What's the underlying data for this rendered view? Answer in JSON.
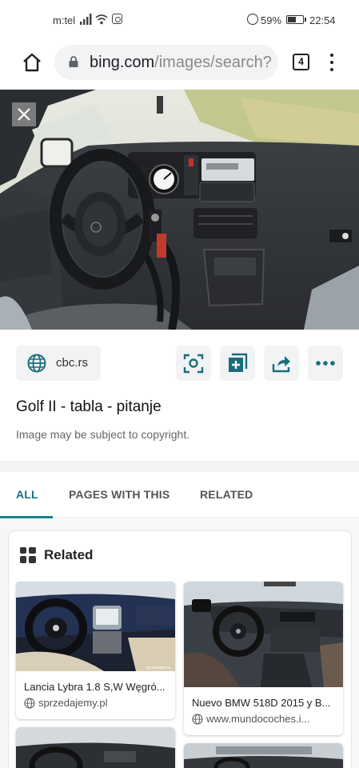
{
  "status_bar": {
    "carrier": "m:tel",
    "battery_percent": "59%",
    "battery_level": 0.59,
    "time": "22:54",
    "icons": [
      "signal-icon",
      "wifi-icon",
      "instagram-icon",
      "alarm-icon",
      "battery-icon"
    ]
  },
  "browser": {
    "url_domain": "bing.com",
    "url_path": "/images/search?",
    "tab_count": "4",
    "icons": [
      "home-icon",
      "lock-icon",
      "tabs-icon",
      "more-vert-icon"
    ]
  },
  "image_detail": {
    "close_icon": "close-icon",
    "source": "cbc.rs",
    "title": "Golf II - tabla - pitanje",
    "copyright_note": "Image may be subject to copyright.",
    "actions": [
      "visual-search-icon",
      "add-collection-icon",
      "share-icon",
      "more-horiz-icon"
    ]
  },
  "tabs": [
    {
      "label": "ALL",
      "active": true
    },
    {
      "label": "PAGES WITH THIS",
      "active": false
    },
    {
      "label": "RELATED",
      "active": false
    }
  ],
  "related": {
    "heading": "Related",
    "items": [
      {
        "title": "Lancia Lybra 1.8 S,W Węgró...",
        "source": "sprzedajemy.pl",
        "watermark": "sprzedajemy"
      },
      {
        "title": "Nuevo BMW 518D 2015 y B...",
        "source": "www.mundocoches.i..."
      },
      {
        "title": "",
        "source": ""
      },
      {
        "title": "",
        "source": ""
      }
    ]
  },
  "colors": {
    "accent": "#1a7f8e",
    "icon_teal": "#1a6e7c",
    "chip_bg": "#f1f3f4"
  }
}
